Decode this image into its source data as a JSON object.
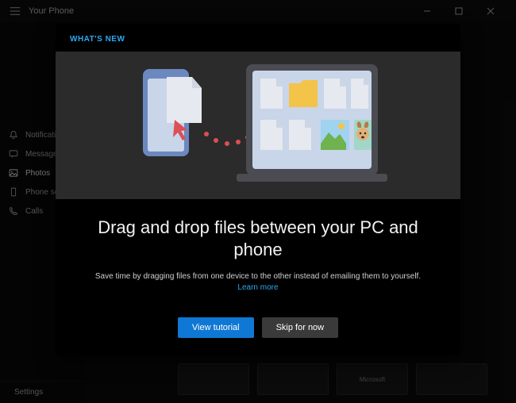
{
  "titlebar": {
    "title": "Your Phone"
  },
  "sidebar": {
    "items": [
      {
        "label": "Notifications"
      },
      {
        "label": "Messages"
      },
      {
        "label": "Photos"
      },
      {
        "label": "Phone screen"
      },
      {
        "label": "Calls"
      }
    ],
    "settings_label": "Settings"
  },
  "modal": {
    "heading": "WHAT'S NEW",
    "title": "Drag and drop files between your PC and phone",
    "description": "Save time by dragging files from one device to the other instead of emailing them to yourself.",
    "learn_more": "Learn more",
    "primary_btn": "View tutorial",
    "secondary_btn": "Skip for now"
  },
  "bg": {
    "tile_label": "Microsoft"
  }
}
